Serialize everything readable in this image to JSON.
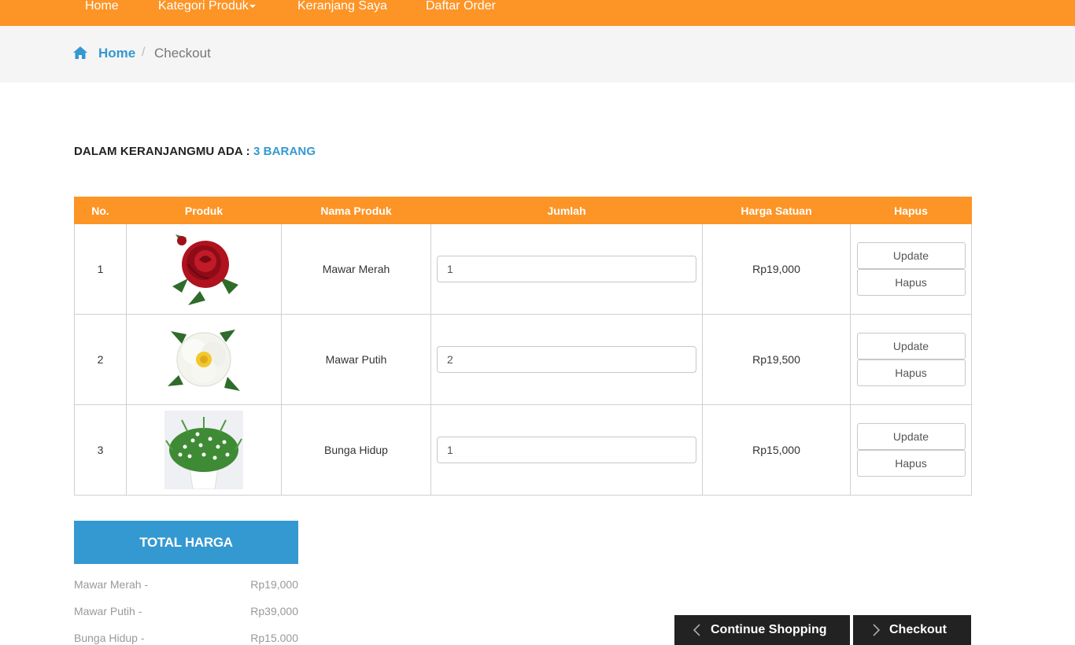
{
  "nav": {
    "items": [
      "Home",
      "Kategori Produk",
      "Keranjang Saya",
      "Daftar Order"
    ]
  },
  "breadcrumb": {
    "home": "Home",
    "separator": "/",
    "current": "Checkout"
  },
  "cart": {
    "heading": "DALAM KERANJANGMU ADA :",
    "count": "3 BARANG"
  },
  "table": {
    "headers": [
      "No.",
      "Produk",
      "Nama Produk",
      "Jumlah",
      "Harga Satuan",
      "Hapus"
    ],
    "rows": [
      {
        "no": "1",
        "name": "Mawar Merah",
        "qty": "1",
        "price": "Rp19,000",
        "update": "Update",
        "delete": "Hapus",
        "image": "red-rose"
      },
      {
        "no": "2",
        "name": "Mawar Putih",
        "qty": "2",
        "price": "Rp19,500",
        "update": "Update",
        "delete": "Hapus",
        "image": "white-rose"
      },
      {
        "no": "3",
        "name": "Bunga Hidup",
        "qty": "1",
        "price": "Rp15,000",
        "update": "Update",
        "delete": "Hapus",
        "image": "potted-flowers"
      }
    ]
  },
  "total": {
    "title": "TOTAL HARGA",
    "lines": [
      {
        "name": "Mawar Merah -",
        "price": "Rp19,000"
      },
      {
        "name": "Mawar Putih -",
        "price": "Rp39,000"
      },
      {
        "name": "Bunga Hidup -",
        "price": "Rp15.000"
      }
    ]
  },
  "actions": {
    "continue": "Continue Shopping",
    "checkout": "Checkout"
  },
  "colors": {
    "nav_bg": "#fd9426",
    "accent_blue": "#3498d1",
    "dark_button": "#222222"
  }
}
